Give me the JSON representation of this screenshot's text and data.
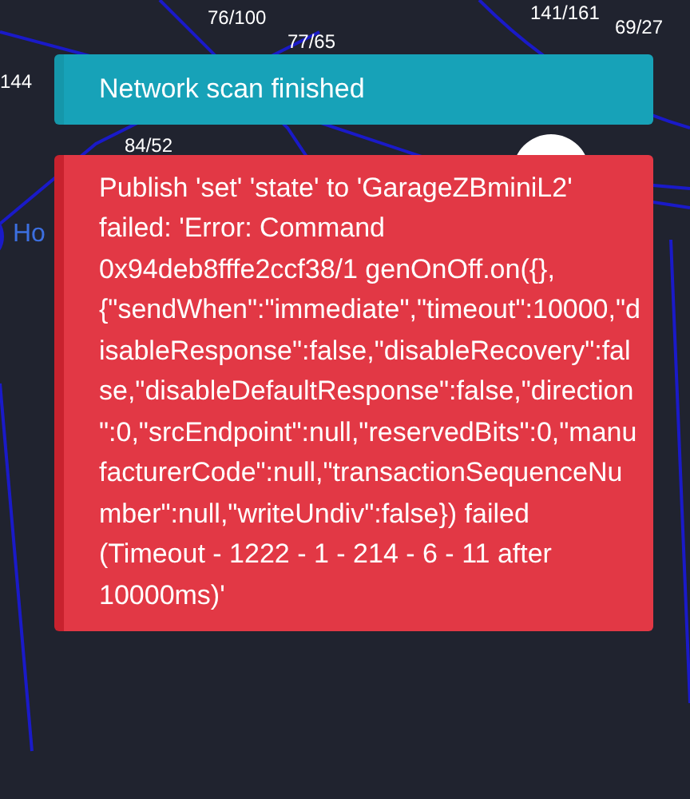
{
  "map": {
    "link_labels": [
      {
        "text": "141/161"
      },
      {
        "text": "69/27"
      },
      {
        "text": "76/100"
      },
      {
        "text": "77/65"
      },
      {
        "text": "144"
      },
      {
        "text": "84/52"
      }
    ],
    "node_labels": [
      {
        "text": "Ho"
      }
    ]
  },
  "toasts": [
    {
      "kind": "info",
      "message": "Network scan finished"
    },
    {
      "kind": "error",
      "message": "Publish 'set' 'state' to 'GarageZBminiL2' failed: 'Error: Command 0x94deb8fffe2ccf38/1 genOnOff.on({}, {\"sendWhen\":\"immediate\",\"timeout\":10000,\"disableResponse\":false,\"disableRecovery\":false,\"disableDefaultResponse\":false,\"direction\":0,\"srcEndpoint\":null,\"reservedBits\":0,\"manufacturerCode\":null,\"transactionSequenceNumber\":null,\"writeUndiv\":false}) failed (Timeout - 1222 - 1 - 214 - 6 - 11 after 10000ms)'"
    }
  ]
}
